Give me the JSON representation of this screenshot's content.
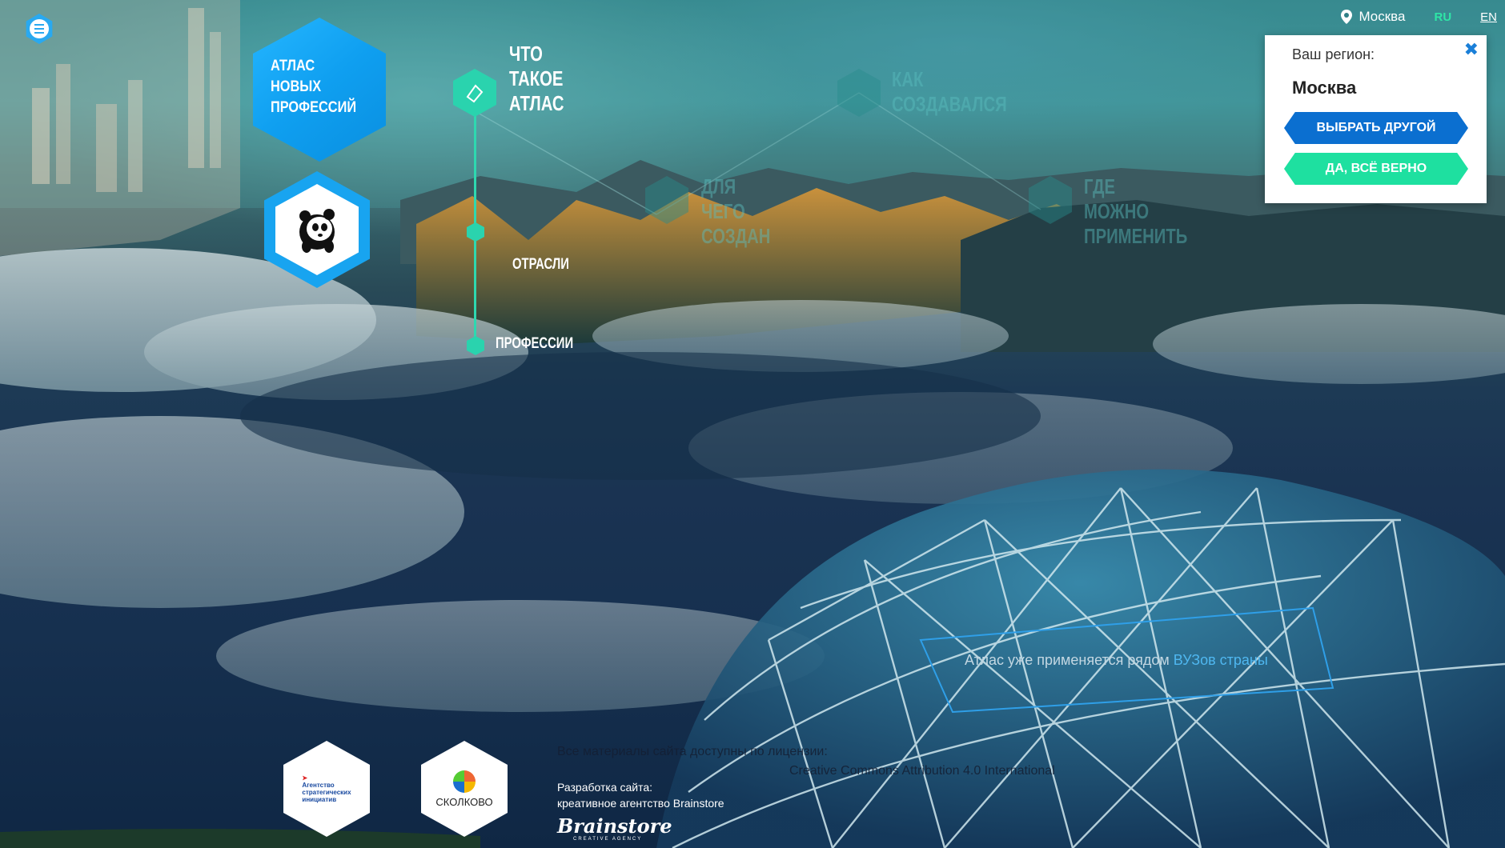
{
  "topbar": {
    "location": "Москва",
    "lang_ru": "RU",
    "lang_en": "EN"
  },
  "logo": {
    "title_line1": "Атлас",
    "title_line2": "новых",
    "title_line3": "профессий"
  },
  "nav": {
    "main_line1": "Что",
    "main_line2": "такое",
    "main_line3": "атлас",
    "sub_items": [
      "Отрасли",
      "Профессии"
    ],
    "faded": [
      {
        "line1": "Как",
        "line2": "создавался",
        "line3": ""
      },
      {
        "line1": "Для",
        "line2": "чего",
        "line3": "создан"
      },
      {
        "line1": "Где",
        "line2": "можно",
        "line3": "применить"
      }
    ]
  },
  "region_popup": {
    "label": "Ваш регион:",
    "city": "Москва",
    "close": "✖",
    "btn_other": "ВЫБРАТЬ ДРУГОЙ",
    "btn_ok": "ДА, ВСЁ ВЕРНО"
  },
  "dome": {
    "text": "Атлас уже применяется рядом ",
    "link": "ВУЗов страны"
  },
  "footer": {
    "partner1_line1": "Агентство",
    "partner1_line2": "стратегических",
    "partner1_line3": "инициатив",
    "partner2": "СКОЛКОВО",
    "license_line1": "Все материалы сайта доступны по лицензии:",
    "license_line2": "Creative Commons Attribution 4.0 International",
    "dev_label": "Разработка сайта:",
    "dev_agency": "креативное агентство Brainstore",
    "brainstore_logo": "Brainstore",
    "brainstore_sub": "CREATIVE AGENCY"
  },
  "colors": {
    "accent_blue": "#1aa5f2",
    "accent_green": "#2ad3ae",
    "button_blue": "#0b6fd0",
    "button_green": "#1ee0a0"
  }
}
